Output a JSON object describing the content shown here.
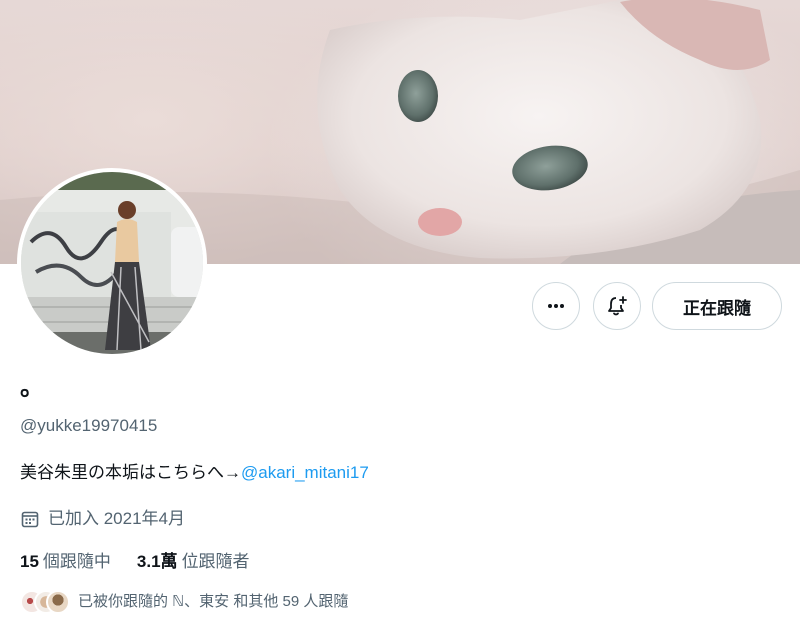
{
  "profile": {
    "display_name": "。",
    "handle": "@yukke19970415",
    "bio_text": "美谷朱里の本垢はこちらへ→",
    "bio_mention": "@akari_mitani17",
    "joined": "已加入 2021年4月"
  },
  "actions": {
    "more_icon": "more-icon",
    "notify_icon": "bell-plus-icon",
    "following_label": "正在跟隨"
  },
  "stats": {
    "following_count": "15",
    "following_label": "個跟隨中",
    "followers_count": "3.1萬",
    "followers_label": "位跟隨者"
  },
  "followed_by": {
    "text": "已被你跟隨的 ℕ、東安 和其他 59 人跟隨"
  },
  "colors": {
    "accent": "#1d9bf0",
    "secondary_text": "#536471",
    "border": "#cfd9de"
  }
}
